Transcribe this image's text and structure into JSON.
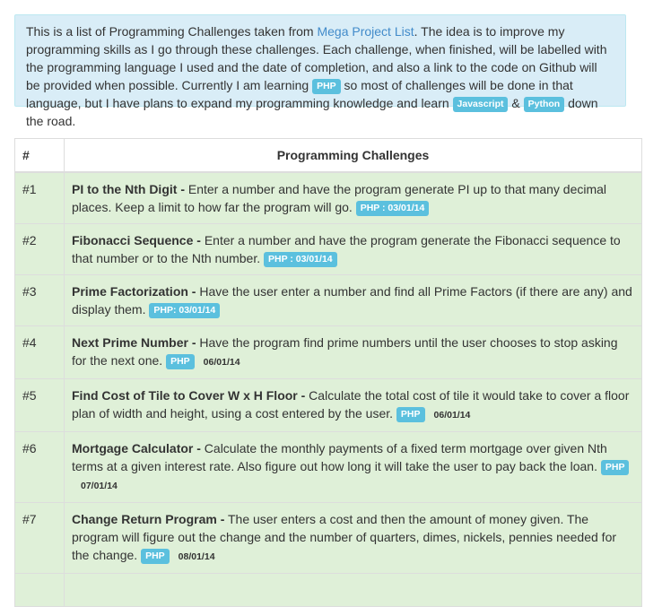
{
  "intro": {
    "text1": "This is a list of Programming Challenges taken from ",
    "link": "Mega Project List",
    "text2": ". The idea is to improve my programming skills as I go through these challenges. Each challenge, when finished, will be labelled with the programming language I used and the date of completion, and also a link to the code on Github will be provided when possible. Currently I am learning ",
    "label_php": "PHP",
    "text3": " so most of challenges will be done in that language, but I have plans to expand my programming knowledge and learn ",
    "label_js": "Javascript",
    "text4": " & ",
    "label_py": "Python",
    "text5": " down the road."
  },
  "table": {
    "col_num": "#",
    "col_title": "Programming Challenges",
    "rows": [
      {
        "num": "#1",
        "title": "PI to the Nth Digit -",
        "desc": " Enter a number and have the program generate PI up to that many decimal places. Keep a limit to how far the program will go. ",
        "label": "PHP : 03/01/14",
        "date": ""
      },
      {
        "num": "#2",
        "title": "Fibonacci Sequence -",
        "desc": " Enter a number and have the program generate the Fibonacci sequence to that number or to the Nth number. ",
        "label": "PHP : 03/01/14",
        "date": ""
      },
      {
        "num": "#3",
        "title": "Prime Factorization -",
        "desc": " Have the user enter a number and find all Prime Factors (if there are any) and display them. ",
        "label": "PHP: 03/01/14",
        "date": ""
      },
      {
        "num": "#4",
        "title": "Next Prime Number -",
        "desc": " Have the program find prime numbers until the user chooses to stop asking for the next one. ",
        "label": "PHP",
        "date": "06/01/14"
      },
      {
        "num": "#5",
        "title": "Find Cost of Tile to Cover W x H Floor -",
        "desc": " Calculate the total cost of tile it would take to cover a floor plan of width and height, using a cost entered by the user. ",
        "label": "PHP",
        "date": "06/01/14"
      },
      {
        "num": "#6",
        "title": "Mortgage Calculator -",
        "desc": " Calculate the monthly payments of a fixed term mortgage over given Nth terms at a given interest rate. Also figure out how long it will take the user to pay back the loan. ",
        "label": "PHP",
        "date": "07/01/14"
      },
      {
        "num": "#7",
        "title": "Change Return Program -",
        "desc": " The user enters a cost and then the amount of money given. The program will figure out the change and the number of quarters, dimes, nickels, pennies needed for the change. ",
        "label": "PHP",
        "date": "08/01/14"
      },
      {
        "num": "",
        "title": "",
        "desc": "",
        "label": "",
        "date": ""
      }
    ]
  }
}
